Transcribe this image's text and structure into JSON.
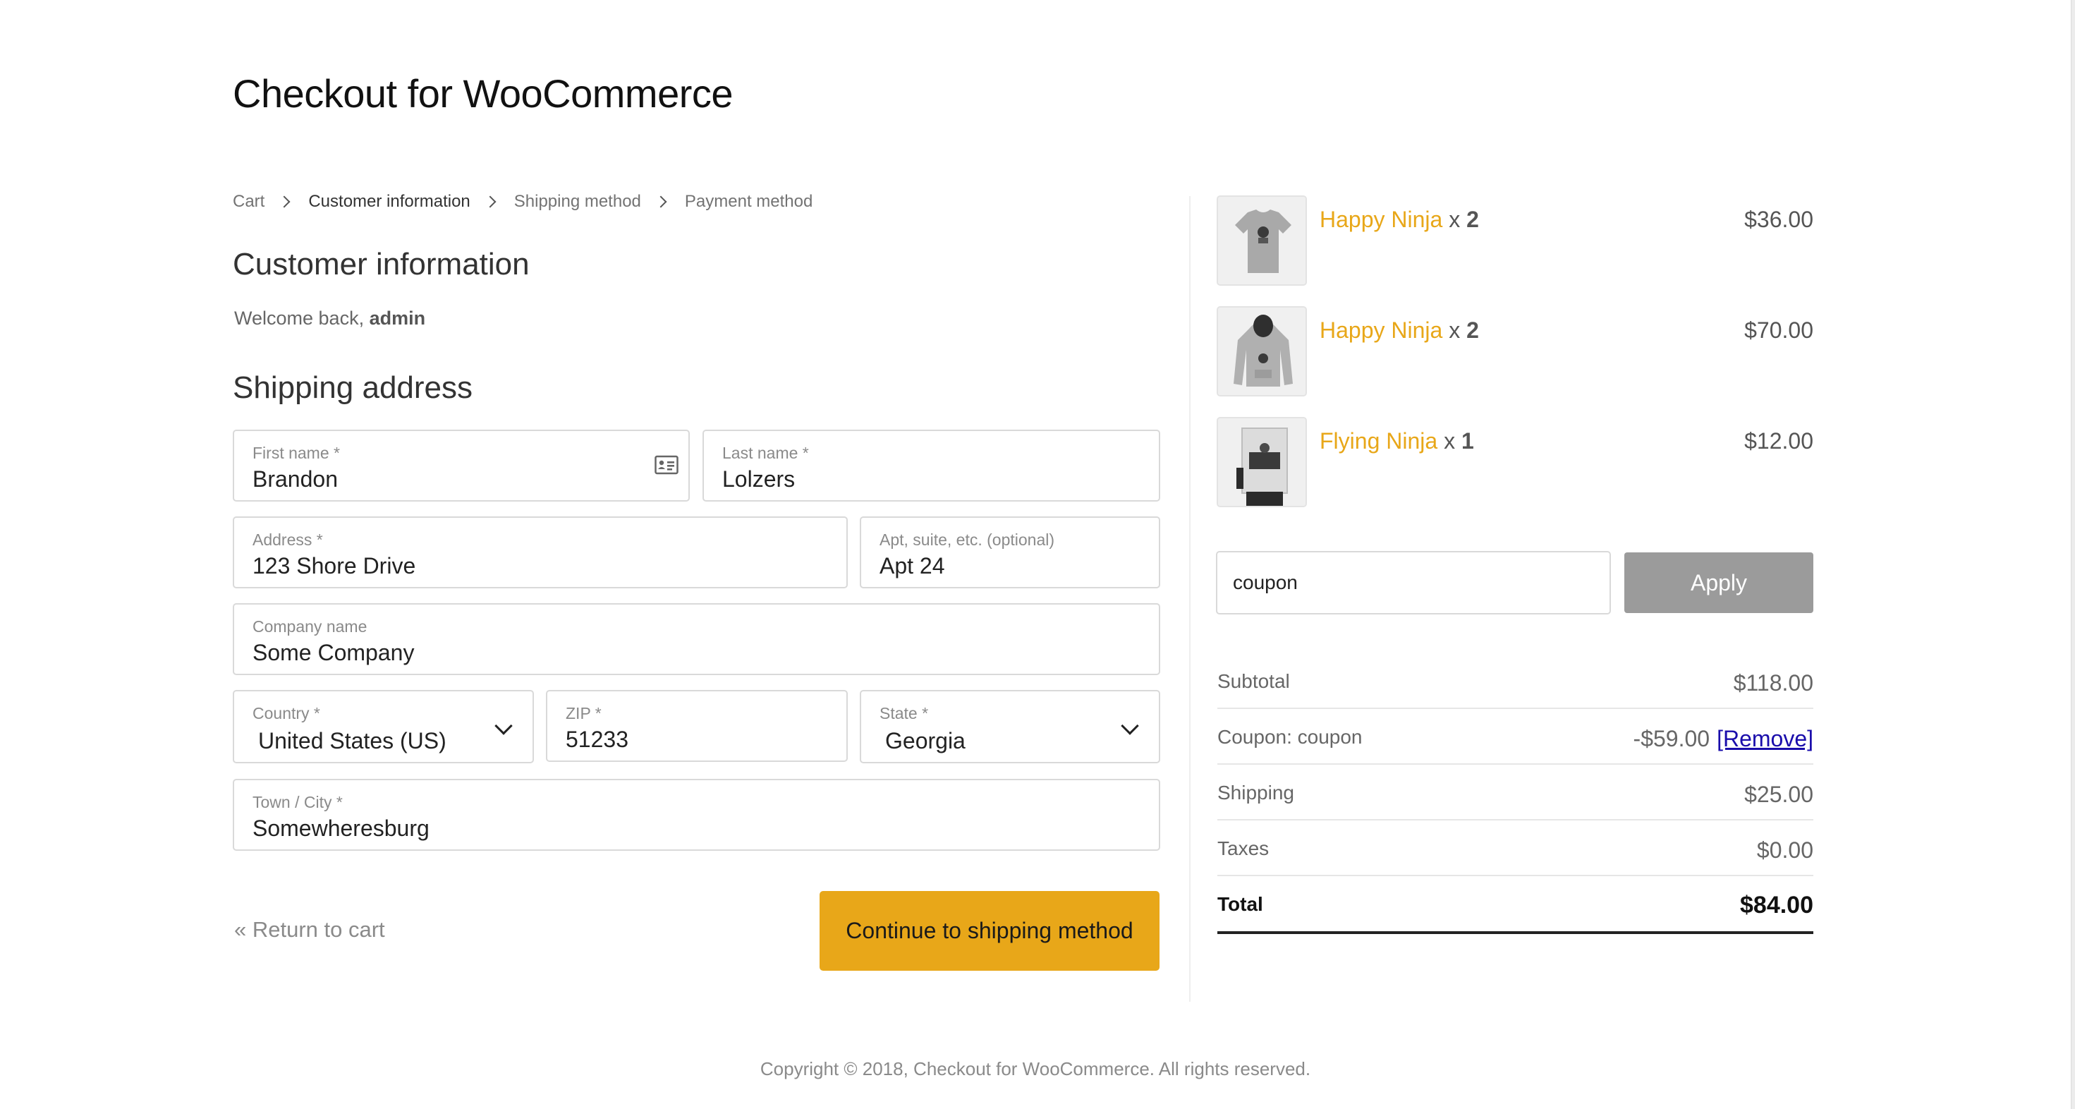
{
  "header": {
    "title": "Checkout for WooCommerce"
  },
  "breadcrumb": {
    "items": [
      {
        "label": "Cart",
        "active": false
      },
      {
        "label": "Customer information",
        "active": true
      },
      {
        "label": "Shipping method",
        "active": false
      },
      {
        "label": "Payment method",
        "active": false
      }
    ]
  },
  "customer": {
    "title": "Customer information",
    "welcome_prefix": "Welcome back, ",
    "welcome_user": "admin"
  },
  "shipping": {
    "title": "Shipping address",
    "fields": {
      "first_name": {
        "label": "First name *",
        "value": "Brandon"
      },
      "last_name": {
        "label": "Last name *",
        "value": "Lolzers"
      },
      "address": {
        "label": "Address *",
        "value": "123 Shore Drive"
      },
      "apt": {
        "label": "Apt, suite, etc. (optional)",
        "value": "Apt 24"
      },
      "company": {
        "label": "Company name",
        "value": "Some Company"
      },
      "country": {
        "label": "Country *",
        "value": "United States (US)"
      },
      "zip": {
        "label": "ZIP *",
        "value": "51233"
      },
      "state": {
        "label": "State *",
        "value": "Georgia"
      },
      "city": {
        "label": "Town / City *",
        "value": "Somewheresburg"
      }
    }
  },
  "actions": {
    "return_label": "« Return to cart",
    "continue_label": "Continue to shipping method"
  },
  "cart": {
    "items": [
      {
        "name": "Happy Ninja",
        "qty_prefix": " x ",
        "qty": "2",
        "price": "$36.00",
        "image": "tshirt-icon"
      },
      {
        "name": "Happy Ninja",
        "qty_prefix": " x ",
        "qty": "2",
        "price": "$70.00",
        "image": "hoodie-icon"
      },
      {
        "name": "Flying Ninja",
        "qty_prefix": " x ",
        "qty": "1",
        "price": "$12.00",
        "image": "poster-icon"
      }
    ]
  },
  "coupon": {
    "value": "coupon",
    "apply_label": "Apply"
  },
  "totals": {
    "subtotal": {
      "label": "Subtotal",
      "value": "$118.00"
    },
    "coupon": {
      "label": "Coupon: coupon",
      "value": "-$59.00",
      "remove_label": "[Remove]"
    },
    "shipping": {
      "label": "Shipping",
      "value": "$25.00"
    },
    "taxes": {
      "label": "Taxes",
      "value": "$0.00"
    },
    "total": {
      "label": "Total",
      "value": "$84.00"
    }
  },
  "footer": {
    "copyright": "Copyright © 2018, Checkout for WooCommerce. All rights reserved."
  },
  "colors": {
    "accent": "#e8a719",
    "apply_button": "#9b9b9b",
    "link": "#1a0dab"
  }
}
